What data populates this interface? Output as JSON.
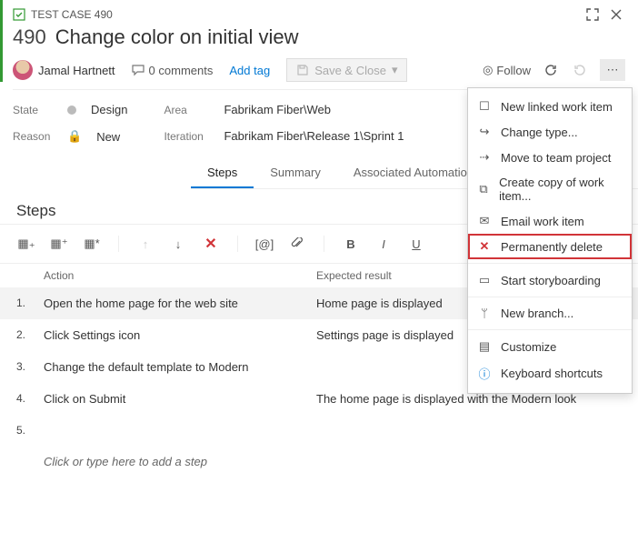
{
  "header": {
    "type_label": "TEST CASE 490",
    "id": "490",
    "title": "Change color on initial view",
    "user": "Jamal Hartnett",
    "comments_count": "0 comments",
    "add_tag": "Add tag",
    "save_close": "Save & Close",
    "follow": "Follow"
  },
  "fields": {
    "state_label": "State",
    "state_value": "Design",
    "reason_label": "Reason",
    "reason_value": "New",
    "area_label": "Area",
    "area_value": "Fabrikam Fiber\\Web",
    "iteration_label": "Iteration",
    "iteration_value": "Fabrikam Fiber\\Release 1\\Sprint 1"
  },
  "tabs": {
    "steps": "Steps",
    "summary": "Summary",
    "assoc": "Associated Automation"
  },
  "section_title": "Steps",
  "columns": {
    "action": "Action",
    "expected": "Expected result"
  },
  "steps": [
    {
      "n": "1.",
      "action": "Open the home page for the web site",
      "expected": "Home page is displayed"
    },
    {
      "n": "2.",
      "action": "Click Settings icon",
      "expected": "Settings page is displayed"
    },
    {
      "n": "3.",
      "action": "Change the default template to Modern",
      "expected": ""
    },
    {
      "n": "4.",
      "action": "Click on Submit",
      "expected": "The home page is displayed with the Modern look"
    },
    {
      "n": "5.",
      "action": "",
      "expected": ""
    }
  ],
  "placeholder": "Click or type here to add a step",
  "menu": {
    "new_linked": "New linked work item",
    "change_type": "Change type...",
    "move": "Move to team project",
    "copy": "Create copy of work item...",
    "email": "Email work item",
    "delete": "Permanently delete",
    "storyboard": "Start storyboarding",
    "branch": "New branch...",
    "customize": "Customize",
    "shortcuts": "Keyboard shortcuts"
  }
}
